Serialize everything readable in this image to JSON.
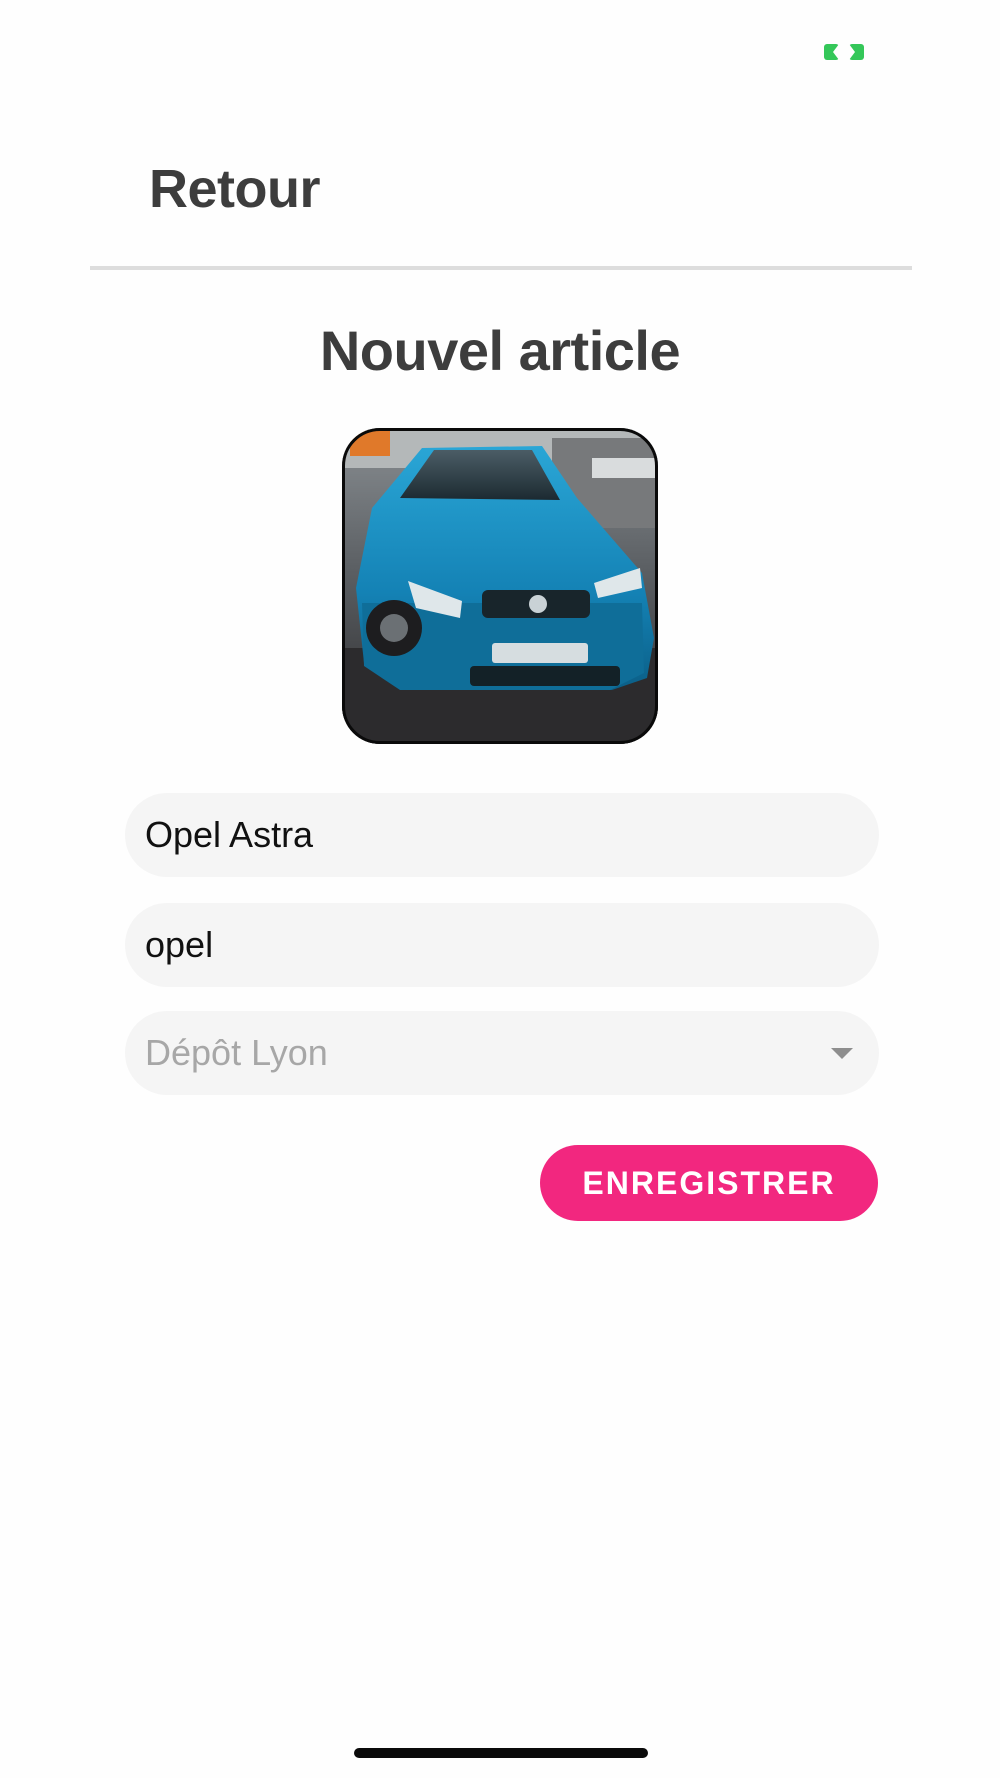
{
  "header": {
    "back_label": "Retour"
  },
  "page": {
    "title": "Nouvel article"
  },
  "photo": {
    "subject": "car-photo"
  },
  "form": {
    "name_value": "Opel Astra",
    "brand_value": "opel",
    "depot_selected": "Dépôt Lyon",
    "save_label": "ENREGISTRER"
  },
  "colors": {
    "accent": "#f2277f",
    "status_green": "#34c759",
    "title_text": "#3d3d3d",
    "field_bg": "#f5f5f5",
    "placeholder_text": "#a7a7a7"
  }
}
